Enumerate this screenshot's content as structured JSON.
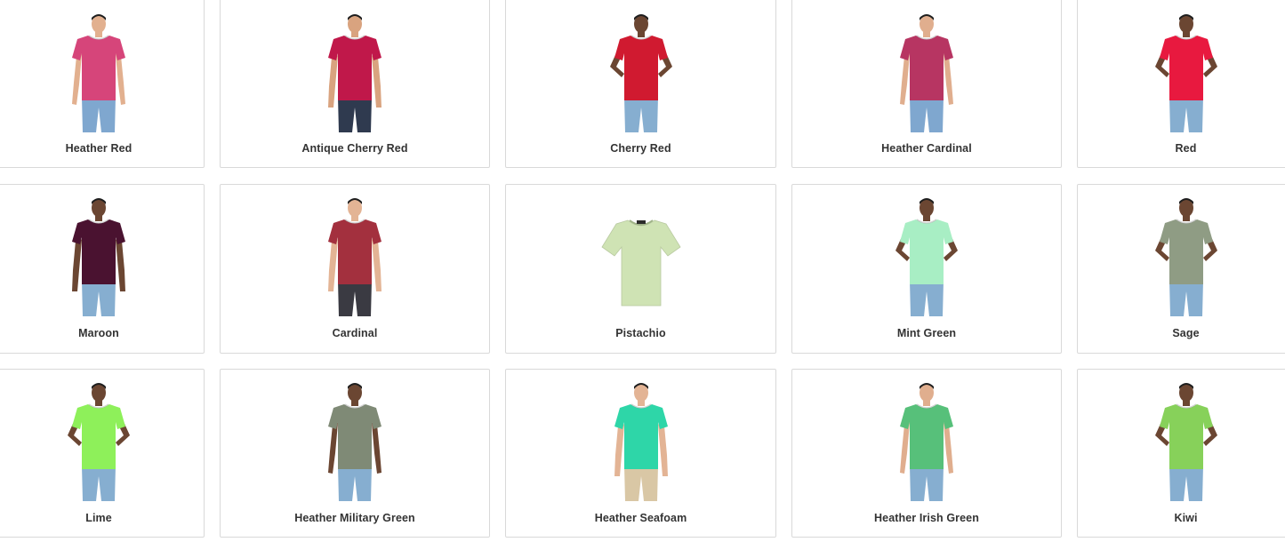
{
  "swatches": [
    {
      "label": "Heather Red",
      "color": "#d6457a",
      "pants": "#7fa7cf",
      "skin": "#e2b08f",
      "pose": "side",
      "flat": false
    },
    {
      "label": "Antique Cherry Red",
      "color": "#c0184a",
      "pants": "#2f3a4f",
      "skin": "#d9a37f",
      "pose": "front",
      "flat": false
    },
    {
      "label": "Cherry Red",
      "color": "#d01a30",
      "pants": "#86aed0",
      "skin": "#6b4632",
      "pose": "hands",
      "flat": false
    },
    {
      "label": "Heather Cardinal",
      "color": "#b73562",
      "pants": "#7fa7cf",
      "skin": "#e0ae8e",
      "pose": "side",
      "flat": false
    },
    {
      "label": "Red",
      "color": "#e8193f",
      "pants": "#86aed0",
      "skin": "#6b4632",
      "pose": "hands",
      "flat": false
    },
    {
      "label": "Maroon",
      "color": "#4a1230",
      "pants": "#86aed0",
      "skin": "#6b4632",
      "pose": "front",
      "flat": false
    },
    {
      "label": "Cardinal",
      "color": "#a3303e",
      "pants": "#3a3a42",
      "skin": "#e3b495",
      "pose": "front",
      "flat": false
    },
    {
      "label": "Pistachio",
      "color": "#cfe3b4",
      "pants": "",
      "skin": "",
      "pose": "flat",
      "flat": true
    },
    {
      "label": "Mint Green",
      "color": "#a8eec4",
      "pants": "#86aed0",
      "skin": "#6b4632",
      "pose": "hands",
      "flat": false
    },
    {
      "label": "Sage",
      "color": "#8f9c84",
      "pants": "#86aed0",
      "skin": "#6b4632",
      "pose": "hands",
      "flat": false
    },
    {
      "label": "Lime",
      "color": "#8ef05a",
      "pants": "#86aed0",
      "skin": "#6b4632",
      "pose": "hands",
      "flat": false
    },
    {
      "label": "Heather Military Green",
      "color": "#7f8a76",
      "pants": "#86aed0",
      "skin": "#6b4632",
      "pose": "side",
      "flat": false
    },
    {
      "label": "Heather Seafoam",
      "color": "#2ed6a8",
      "pants": "#d9c7a5",
      "skin": "#e3b495",
      "pose": "front",
      "flat": false
    },
    {
      "label": "Heather Irish Green",
      "color": "#57c07a",
      "pants": "#86aed0",
      "skin": "#e0ae8e",
      "pose": "side",
      "flat": false
    },
    {
      "label": "Kiwi",
      "color": "#87d15a",
      "pants": "#86aed0",
      "skin": "#6b4632",
      "pose": "hands",
      "flat": false
    }
  ]
}
